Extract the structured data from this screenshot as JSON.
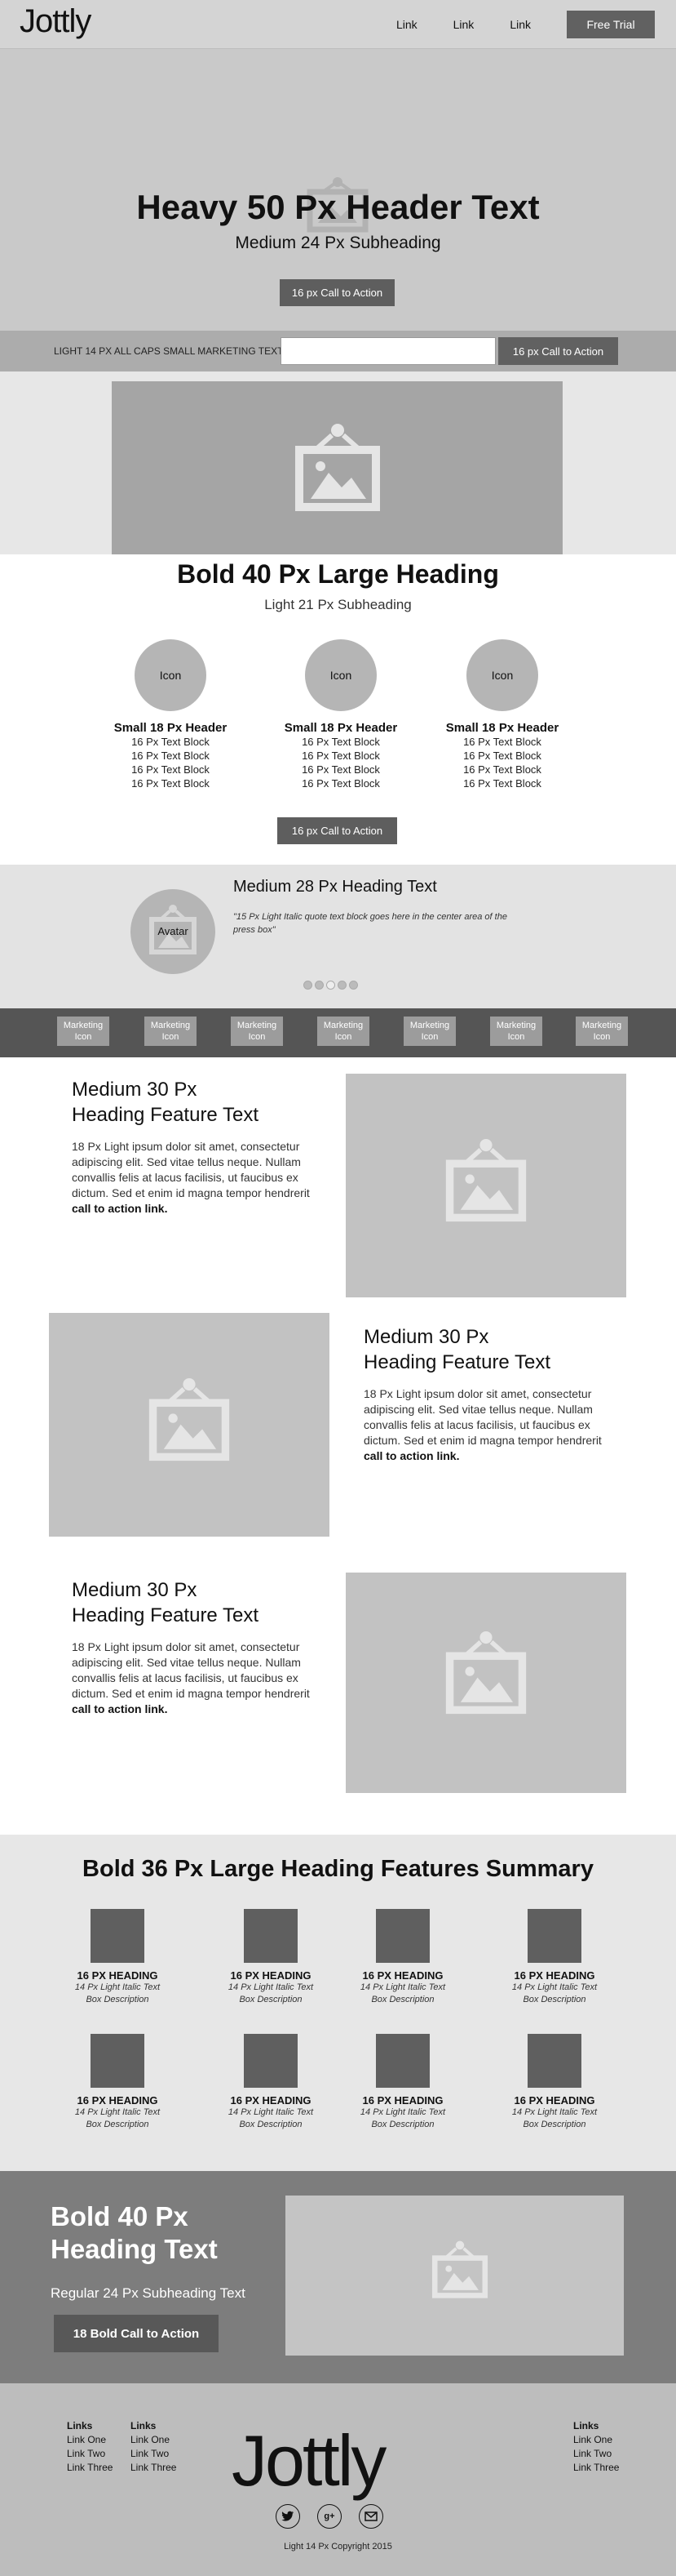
{
  "nav": {
    "logo": "Jottly",
    "links": [
      "Link",
      "Link",
      "Link"
    ],
    "trial_button": "Free Trial"
  },
  "hero": {
    "title": "Heavy 50 Px Header Text",
    "subtitle": "Medium 24 Px Subheading",
    "cta": "16 px Call to Action"
  },
  "signup": {
    "label": "LIGHT 14 PX ALL CAPS SMALL MARKETING TEXT",
    "input_value": "",
    "button": "16 px Call to Action"
  },
  "features3": {
    "title": "Bold 40 Px Large Heading",
    "subtitle": "Light 21 Px Subheading",
    "columns": [
      {
        "icon": "Icon",
        "header": "Small 18 Px Header",
        "lines": [
          "16 Px Text Block",
          "16 Px Text Block",
          "16 Px Text Block",
          "16 Px Text Block"
        ]
      },
      {
        "icon": "Icon",
        "header": "Small 18 Px Header",
        "lines": [
          "16 Px Text Block",
          "16 Px Text Block",
          "16 Px Text Block",
          "16 Px Text Block"
        ]
      },
      {
        "icon": "Icon",
        "header": "Small 18 Px Header",
        "lines": [
          "16 Px Text Block",
          "16 Px Text Block",
          "16 Px Text Block",
          "16 Px Text Block"
        ]
      }
    ],
    "cta": "16 px Call to Action"
  },
  "testimonial": {
    "avatar_label": "Avatar",
    "heading": "Medium 28 Px Heading Text",
    "quote": "\"15 Px Light Italic quote text block goes here in the center area of the press box\"",
    "dots": 5,
    "active_dot": 3
  },
  "marketing": {
    "items": [
      "Marketing Icon",
      "Marketing Icon",
      "Marketing Icon",
      "Marketing Icon",
      "Marketing Icon",
      "Marketing Icon",
      "Marketing Icon"
    ]
  },
  "feature_rows": [
    {
      "heading_line1": "Medium 30 Px",
      "heading_line2": "Heading Feature Text",
      "body": "18 Px Light ipsum dolor sit amet, consectetur adipiscing elit. Sed vitae tellus neque. Nullam convallis felis at lacus facilisis, ut faucibus ex dictum. Sed et enim id magna tempor hendrerit",
      "link": "call to action link."
    },
    {
      "heading_line1": "Medium 30 Px",
      "heading_line2": "Heading Feature Text",
      "body": "18 Px Light ipsum dolor sit amet, consectetur adipiscing elit. Sed vitae tellus neque. Nullam convallis felis at lacus facilisis, ut faucibus ex dictum. Sed et enim id magna tempor hendrerit",
      "link": "call to action link."
    },
    {
      "heading_line1": "Medium 30 Px",
      "heading_line2": "Heading Feature Text",
      "body": "18 Px Light ipsum dolor sit amet, consectetur adipiscing elit. Sed vitae tellus neque. Nullam convallis felis at lacus facilisis, ut faucibus ex dictum. Sed et enim id magna tempor hendrerit",
      "link": "call to action link."
    }
  ],
  "summary": {
    "title": "Bold 36 Px Large Heading Features Summary",
    "items": [
      {
        "heading": "16 PX HEADING",
        "desc1": "14 Px Light Italic Text",
        "desc2": "Box Description"
      },
      {
        "heading": "16 PX HEADING",
        "desc1": "14 Px Light Italic Text",
        "desc2": "Box Description"
      },
      {
        "heading": "16 PX HEADING",
        "desc1": "14 Px Light Italic Text",
        "desc2": "Box Description"
      },
      {
        "heading": "16 PX HEADING",
        "desc1": "14 Px Light Italic Text",
        "desc2": "Box Description"
      },
      {
        "heading": "16 PX HEADING",
        "desc1": "14 Px Light Italic Text",
        "desc2": "Box Description"
      },
      {
        "heading": "16 PX HEADING",
        "desc1": "14 Px Light Italic Text",
        "desc2": "Box Description"
      },
      {
        "heading": "16 PX HEADING",
        "desc1": "14 Px Light Italic Text",
        "desc2": "Box Description"
      },
      {
        "heading": "16 PX HEADING",
        "desc1": "14 Px Light Italic Text",
        "desc2": "Box Description"
      }
    ]
  },
  "cta_block": {
    "heading_line1": "Bold 40 Px",
    "heading_line2": "Heading Text",
    "subheading": "Regular 24 Px Subheading Text",
    "button": "18 Bold Call to Action"
  },
  "footer": {
    "logo": "Jottly",
    "col1": {
      "head": "Links",
      "items": [
        "Link One",
        "Link Two",
        "Link Three"
      ]
    },
    "col2": {
      "head": "Links",
      "items": [
        "Link One",
        "Link Two",
        "Link Three"
      ]
    },
    "col3": {
      "head": "Links",
      "items": [
        "Link One",
        "Link Two",
        "Link Three"
      ]
    },
    "socials": [
      "twitter-icon",
      "google-plus-icon",
      "email-icon"
    ],
    "copyright": "Light 14 Px Copyright 2015"
  },
  "colors": {
    "button_dark": "#5e5e5e",
    "image_placeholder": "#a5a5a5",
    "footer_bg": "#bdbdbd"
  }
}
